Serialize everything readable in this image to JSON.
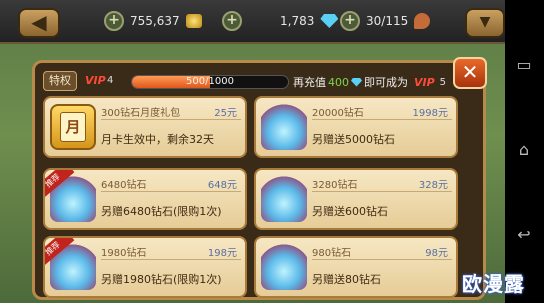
{
  "header": {
    "gold": "755,637",
    "gems": "1,783",
    "stamina": "30/115"
  },
  "vip": {
    "tequan_label": "特权",
    "current_label": "VIP",
    "current_level": "4",
    "progress_text": "500/1000",
    "progress_fraction": 0.5,
    "recharge_prefix": "再充值",
    "recharge_amount": "400",
    "recharge_suffix": "即可成为",
    "next_label": "VIP",
    "next_level": "5"
  },
  "cards": [
    {
      "name": "300钻石月度礼包",
      "price": "25元",
      "desc": "月卡生效中，剩余32天",
      "icon": "month-card-icon",
      "badge": ""
    },
    {
      "name": "20000钻石",
      "price": "1998元",
      "desc": "另赠送5000钻石",
      "icon": "gem-chest-icon",
      "badge": ""
    },
    {
      "name": "6480钻石",
      "price": "648元",
      "desc": "另赠6480钻石(限购1次)",
      "icon": "gem-bowl-icon",
      "badge": "推荐"
    },
    {
      "name": "3280钻石",
      "price": "328元",
      "desc": "另赠送600钻石",
      "icon": "gem-bowl-icon",
      "badge": ""
    },
    {
      "name": "1980钻石",
      "price": "198元",
      "desc": "另赠1980钻石(限购1次)",
      "icon": "gem-pile-icon",
      "badge": "推荐"
    },
    {
      "name": "980钻石",
      "price": "98元",
      "desc": "另赠送80钻石",
      "icon": "gem-pile-icon",
      "badge": ""
    }
  ],
  "month_icon_char": "月",
  "watermark": "欧漫露"
}
